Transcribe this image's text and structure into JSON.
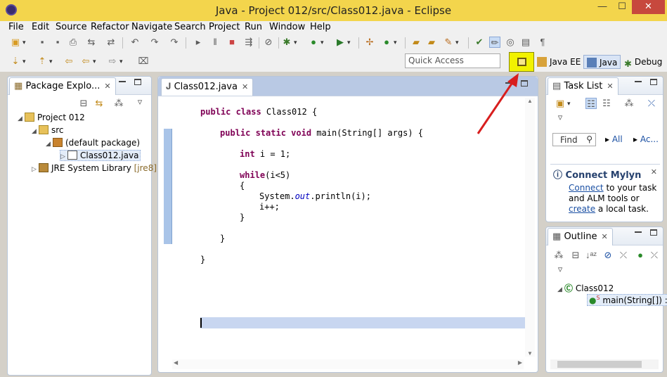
{
  "window": {
    "title": "Java - Project 012/src/Class012.java - Eclipse",
    "min_glyph": "—",
    "max_glyph": "☐",
    "close_glyph": "✕"
  },
  "menu": [
    "File",
    "Edit",
    "Source",
    "Refactor",
    "Navigate",
    "Search",
    "Project",
    "Run",
    "Window",
    "Help"
  ],
  "toolbar": {
    "quick_access_placeholder": "Quick Access",
    "perspectives": {
      "java_ee": "Java EE",
      "java": "Java",
      "debug": "Debug"
    },
    "highlight_color": "#f2f200"
  },
  "package_explorer": {
    "tab_label": "Package Explo...",
    "tree": {
      "project": "Project 012",
      "src": "src",
      "package": "(default package)",
      "file": "Class012.java",
      "jre": "JRE System Library",
      "jre_tag": "[jre8]"
    }
  },
  "editor": {
    "tab_label": "Class012.java",
    "code": {
      "l1_kw": "public class",
      "l1_rest": " Class012 {",
      "l2_kw": "public static void",
      "l2_rest": " main(String[] args) {",
      "l3_kw": "int",
      "l3_rest": " i = 1;",
      "l4_kw": "while",
      "l4_rest": "(i<5)",
      "l5": "{",
      "l6_a": "System.",
      "l6_b": "out",
      "l6_c": ".println(i);",
      "l7": "i++;",
      "l8": "}",
      "l9": "}",
      "l10": "}"
    }
  },
  "task_list": {
    "tab_label": "Task List",
    "find_label": "Find",
    "all_label": "All",
    "ac_label": "Ac...",
    "mylyn": {
      "title": "Connect Mylyn",
      "link1": "Connect",
      "text1": " to your task and ALM tools or ",
      "link2": "create",
      "text2": " a local task."
    }
  },
  "outline": {
    "tab_label": "Outline",
    "class_name": "Class012",
    "method": "main(String[]) :",
    "method_mod": "S"
  },
  "annotation": {
    "arrow_color": "#d81e1e"
  }
}
